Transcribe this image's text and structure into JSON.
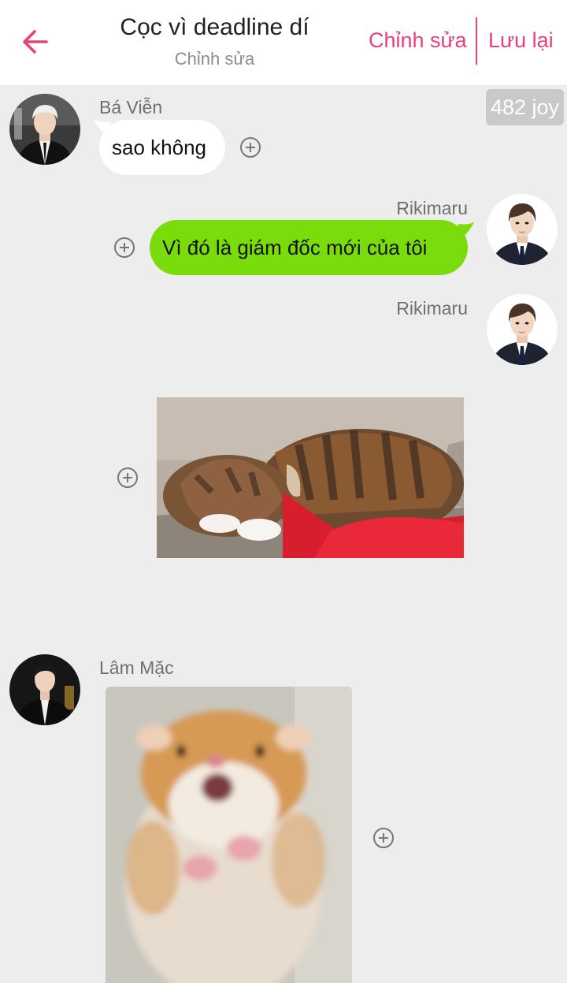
{
  "header": {
    "title": "Cọc vì deadline dí",
    "subtitle": "Chỉnh sửa",
    "edit_label": "Chỉnh sửa",
    "save_label": "Lưu lại",
    "back_icon": "arrow-left-icon"
  },
  "joy_badge": "482 joy",
  "colors": {
    "accent": "#e8407a",
    "sent_bubble": "#7bdc0c",
    "received_bubble": "#ffffff",
    "background": "#ededed"
  },
  "messages": [
    {
      "sender": "Bá Viễn",
      "side": "left",
      "type": "text",
      "text": "sao không"
    },
    {
      "sender": "Rikimaru",
      "side": "right",
      "type": "text",
      "text": "Vì đó là giám đốc mới của tôi"
    },
    {
      "sender": "Rikimaru",
      "side": "right",
      "type": "image",
      "image": "sleeping cat"
    },
    {
      "sender": "Lâm Mặc",
      "side": "left",
      "type": "image",
      "image": "shocked hamster"
    }
  ]
}
